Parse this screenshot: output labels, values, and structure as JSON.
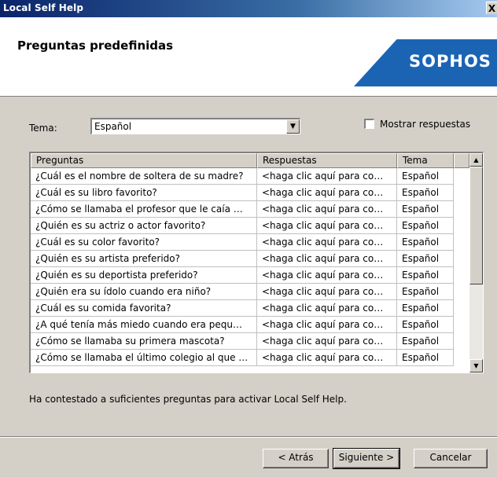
{
  "window": {
    "title": "Local Self Help",
    "close_glyph": "X"
  },
  "header": {
    "title": "Preguntas predefinidas",
    "logo": "SOPHOS",
    "brand_color": "#1b64b4"
  },
  "tema": {
    "label": "Tema:",
    "selected": "Español",
    "arrow_icon": "chevron-down-icon",
    "arrow_glyph": "▼"
  },
  "show_answers": {
    "label": "Mostrar respuestas",
    "checked": false
  },
  "table": {
    "columns": [
      "Preguntas",
      "Respuestas",
      "Tema"
    ],
    "rows": [
      {
        "q": "¿Cuál es el nombre de soltera de su madre?",
        "a": "<haga clic aquí para co…",
        "t": "Español"
      },
      {
        "q": "¿Cuál es su libro favorito?",
        "a": "<haga clic aquí para co…",
        "t": "Español"
      },
      {
        "q": "¿Cómo se llamaba el profesor que le caía …",
        "a": "<haga clic aquí para co…",
        "t": "Español"
      },
      {
        "q": "¿Quién es su actriz o actor favorito?",
        "a": "<haga clic aquí para co…",
        "t": "Español"
      },
      {
        "q": "¿Cuál es su color favorito?",
        "a": "<haga clic aquí para co…",
        "t": "Español"
      },
      {
        "q": "¿Quién es su artista preferido?",
        "a": "<haga clic aquí para co…",
        "t": "Español"
      },
      {
        "q": "¿Quién es su deportista preferido?",
        "a": "<haga clic aquí para co…",
        "t": "Español"
      },
      {
        "q": "¿Quién era su ídolo cuando era niño?",
        "a": "<haga clic aquí para co…",
        "t": "Español"
      },
      {
        "q": "¿Cuál es su comida favorita?",
        "a": "<haga clic aquí para co…",
        "t": "Español"
      },
      {
        "q": "¿A qué tenía más miedo cuando era pequ…",
        "a": "<haga clic aquí para co…",
        "t": "Español"
      },
      {
        "q": "¿Cómo se llamaba su primera mascota?",
        "a": "<haga clic aquí para co…",
        "t": "Español"
      },
      {
        "q": "¿Cómo se llamaba el último colegio al que …",
        "a": "<haga clic aquí para co…",
        "t": "Español"
      }
    ],
    "scroll_up_glyph": "▲",
    "scroll_down_glyph": "▼"
  },
  "status_message": "Ha contestado a suficientes preguntas para activar Local Self Help.",
  "buttons": {
    "back": "< Atrás",
    "next": "Siguiente >",
    "cancel": "Cancelar"
  }
}
